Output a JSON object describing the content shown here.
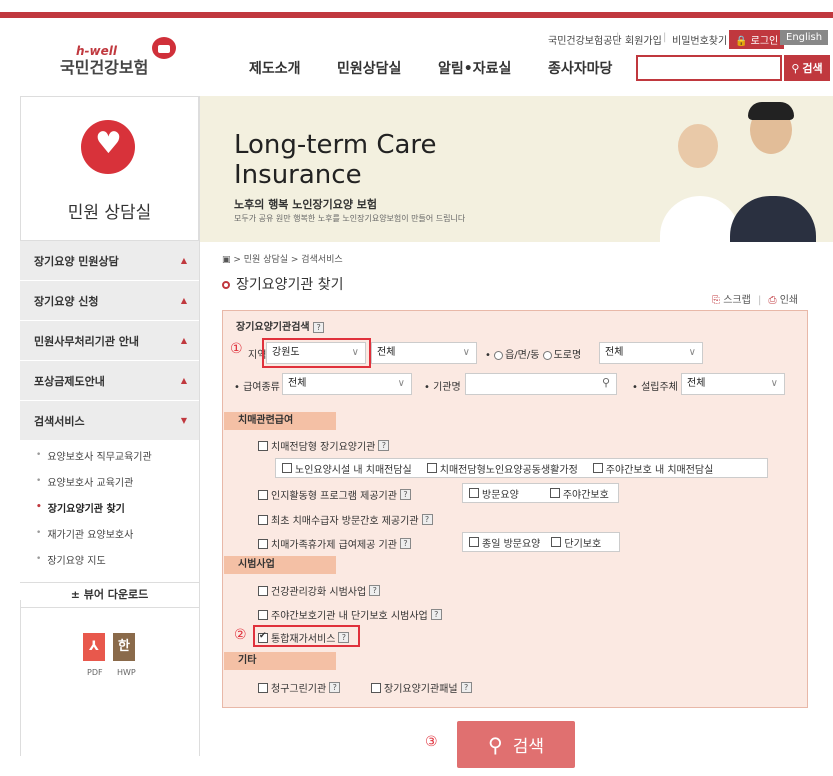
{
  "header": {
    "logo_sub": "h-well",
    "logo_main": "국민건강보험",
    "util_links": [
      "국민건강보험공단",
      "회원가입",
      "비밀번호찾기"
    ],
    "login_label": "로그인",
    "english_label": "English",
    "gnb": [
      "제도소개",
      "민원상담실",
      "알림•자료실",
      "종사자마당"
    ],
    "search_button_label": "검색"
  },
  "sidebar": {
    "title": "민원 상담실",
    "menu": [
      {
        "label": "장기요양 민원상담",
        "arrow": "▲"
      },
      {
        "label": "장기요양 신청",
        "arrow": "▲"
      },
      {
        "label": "민원사무처리기관 안내",
        "arrow": "▲"
      },
      {
        "label": "포상금제도안내",
        "arrow": "▲"
      },
      {
        "label": "검색서비스",
        "arrow": "▼"
      }
    ],
    "submenu": [
      "요양보호사 직무교육기관",
      "요양보호사 교육기관",
      "장기요양기관 찾기",
      "재가기관 요양보호사",
      "장기요양 지도"
    ],
    "viewer_download": "± 뷰어 다운로드",
    "files": [
      {
        "icon": "⅄",
        "label": "PDF"
      },
      {
        "icon": "한",
        "label": "HWP"
      }
    ]
  },
  "banner": {
    "title": "Long-term Care Insurance",
    "subtitle": "노후의 행복 노인장기요양 보험",
    "desc": "모두가 공유 원만 행복한 노후를 노인장기요양보험이 만들어 드립니다"
  },
  "content": {
    "breadcrumb": "민원 상담실 > 검색서비스",
    "title": "장기요양기관 찾기",
    "tools": {
      "scrap": "스크랩",
      "print": "인쇄"
    }
  },
  "search_form": {
    "section_title": "장기요양기관검색",
    "help_glyph": "?",
    "region_label": "지역",
    "region_value": "강원도",
    "district_value": "전체",
    "radio_eup": "읍/면/동",
    "radio_road": "도로명",
    "road_value": "전체",
    "benefit_label": "급여종류",
    "benefit_value": "전체",
    "org_label": "기관명",
    "org_value": "",
    "founder_label": "설립주체",
    "founder_value": "전체",
    "categories": [
      {
        "label": "치매관련급여",
        "items": [
          {
            "label": "치매전담형 장기요양기관",
            "checked": false,
            "help": true
          },
          {
            "label": "노인요양시설 내 치매전담실",
            "checked": false
          },
          {
            "label": "치매전담형노인요양공동생활가정",
            "checked": false
          },
          {
            "label": "주야간보호 내 치매전담실",
            "checked": false
          },
          {
            "label": "인지활동형 프로그램 제공기관",
            "checked": false,
            "help": true
          },
          {
            "label": "방문요양",
            "checked": false
          },
          {
            "label": "주야간보호",
            "checked": false
          },
          {
            "label": "최초 치매수급자 방문간호 제공기관",
            "checked": false,
            "help": true
          },
          {
            "label": "치매가족휴가제 급여제공 기관",
            "checked": false,
            "help": true
          },
          {
            "label": "종일 방문요양",
            "checked": false
          },
          {
            "label": "단기보호",
            "checked": false
          }
        ]
      },
      {
        "label": "시범사업",
        "items": [
          {
            "label": "건강관리강화 시범사업",
            "checked": false,
            "help": true
          },
          {
            "label": "주야간보호기관 내 단기보호 시범사업",
            "checked": false,
            "help": true
          },
          {
            "label": "통합재가서비스",
            "checked": true,
            "help": true
          }
        ]
      },
      {
        "label": "기타",
        "items": [
          {
            "label": "청구그린기관",
            "checked": false,
            "help": true
          },
          {
            "label": "장기요양기관패널",
            "checked": false,
            "help": true
          }
        ]
      }
    ],
    "search_button_label": "검색"
  },
  "annotations": [
    "①",
    "②",
    "③"
  ]
}
